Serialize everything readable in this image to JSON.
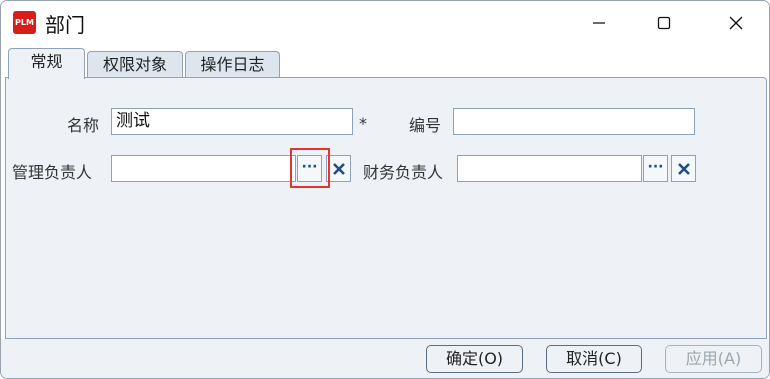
{
  "window": {
    "title": "部门",
    "app_icon_text": "PLM",
    "app_icon_color": "#d81d1d"
  },
  "tabs": [
    {
      "label": "常规",
      "active": true
    },
    {
      "label": "权限对象",
      "active": false
    },
    {
      "label": "操作日志",
      "active": false
    }
  ],
  "form": {
    "name_label": "名称",
    "name_value": "测试",
    "required_mark": "*",
    "number_label": "编号",
    "number_value": "",
    "manager_label": "管理负责人",
    "manager_value": "",
    "finance_label": "财务负责人",
    "finance_value": "",
    "ellipsis_text": "···"
  },
  "buttons": {
    "ok": "确定(O)",
    "cancel": "取消(C)",
    "apply": "应用(A)"
  },
  "colors": {
    "panel_bg": "#eef2f6",
    "highlight": "#e23434"
  }
}
